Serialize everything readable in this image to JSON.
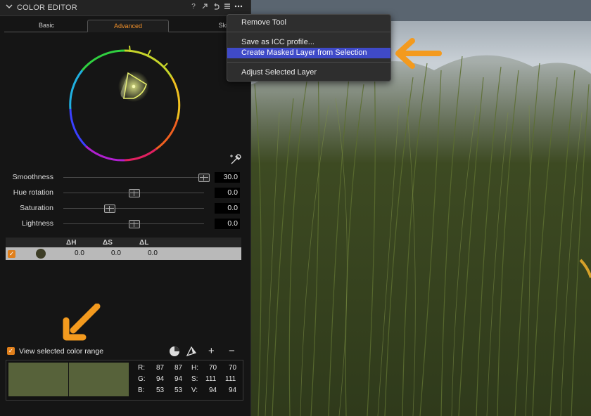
{
  "panel": {
    "title": "COLOR EDITOR",
    "header_icons": [
      "help-icon",
      "expand-icon",
      "reset-icon",
      "list-icon",
      "more-icon"
    ],
    "help_glyph": "?",
    "tabs": [
      {
        "label": "Basic",
        "active": false
      },
      {
        "label": "Advanced",
        "active": true
      },
      {
        "label": "Skin Tone",
        "active": false
      }
    ],
    "sliders": [
      {
        "label": "Smoothness",
        "value": "30.0",
        "position": 0.95
      },
      {
        "label": "Hue rotation",
        "value": "0.0",
        "position": 0.5
      },
      {
        "label": "Saturation",
        "value": "0.0",
        "position": 0.33
      },
      {
        "label": "Lightness",
        "value": "0.0",
        "position": 0.5
      }
    ],
    "corrections": {
      "headers": [
        "ΔH",
        "ΔS",
        "ΔL"
      ],
      "row": {
        "checked": true,
        "swatch_color": "#3d3d26",
        "dh": "0.0",
        "ds": "0.0",
        "dl": "0.0"
      }
    },
    "view_range": {
      "label": "View selected color range",
      "checked": true,
      "plus": "+",
      "minus": "−"
    },
    "swatch_color": "#57623a",
    "color_stats": {
      "r_label": "R:",
      "r1": "87",
      "r2": "87",
      "g_label": "G:",
      "g1": "94",
      "g2": "94",
      "b_label": "B:",
      "b1": "53",
      "b2": "53",
      "h_label": "H:",
      "h1": "70",
      "h2": "70",
      "s_label": "S:",
      "s1": "111",
      "s2": "111",
      "v_label": "V:",
      "v1": "94",
      "v2": "94"
    }
  },
  "menu": {
    "items": [
      {
        "label": "Remove Tool",
        "selected": false
      },
      {
        "label": "Save as ICC profile...",
        "selected": false
      },
      {
        "label": "Create Masked Layer from Selection",
        "selected": true
      },
      {
        "label": "Adjust Selected Layer",
        "selected": false
      }
    ]
  },
  "colors": {
    "accent": "#f0902a",
    "menu_highlight": "#3f4ac8",
    "arrow": "#f39a1e"
  }
}
